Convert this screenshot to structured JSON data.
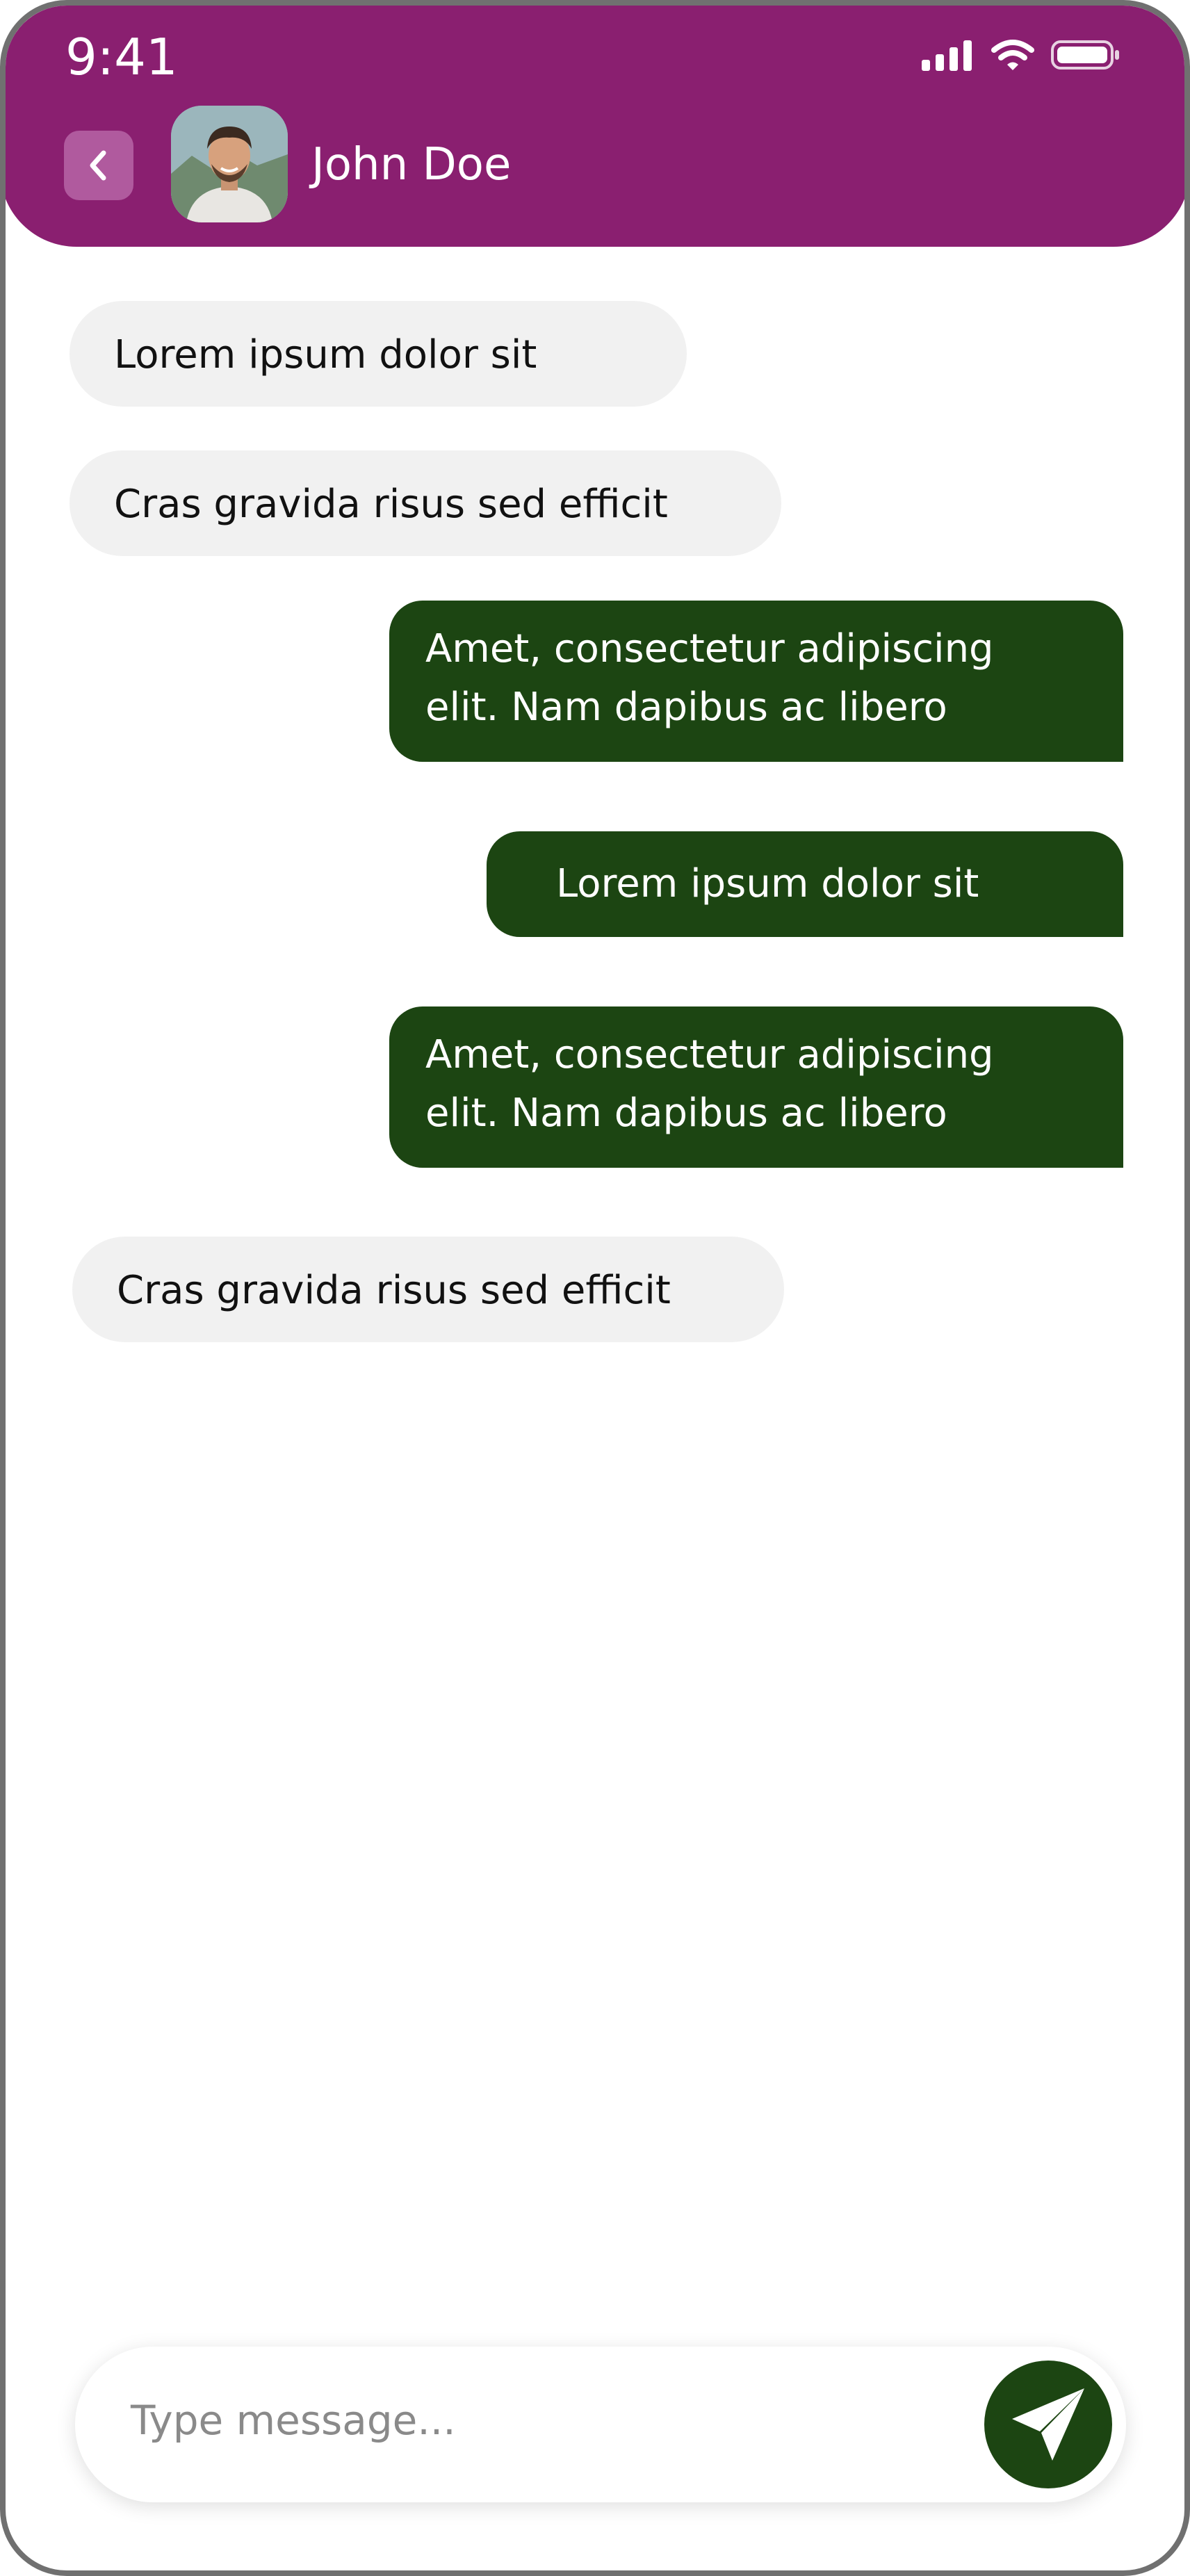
{
  "status_bar": {
    "time": "9:41"
  },
  "header": {
    "contact_name": "John Doe"
  },
  "messages": [
    {
      "direction": "incoming",
      "text": "Lorem ipsum dolor sit"
    },
    {
      "direction": "incoming",
      "text": "Cras gravida risus sed efficit"
    },
    {
      "direction": "outgoing",
      "lines": [
        "Amet, consectetur adipiscing",
        "elit. Nam dapibus ac libero"
      ]
    },
    {
      "direction": "outgoing",
      "text": "Lorem ipsum dolor sit"
    },
    {
      "direction": "outgoing",
      "lines": [
        "Amet, consectetur adipiscing",
        "elit. Nam dapibus ac libero"
      ]
    },
    {
      "direction": "incoming",
      "text": "Cras gravida risus sed efficit"
    }
  ],
  "composer": {
    "placeholder": "Type message..."
  },
  "colors": {
    "header": "#8a1f70",
    "incoming_bubble": "#f1f1f1",
    "outgoing_bubble": "#1c4512",
    "send_button": "#1c4512"
  },
  "icons": [
    "signal-icon",
    "wifi-icon",
    "battery-icon",
    "back-chevron-icon",
    "send-icon"
  ]
}
